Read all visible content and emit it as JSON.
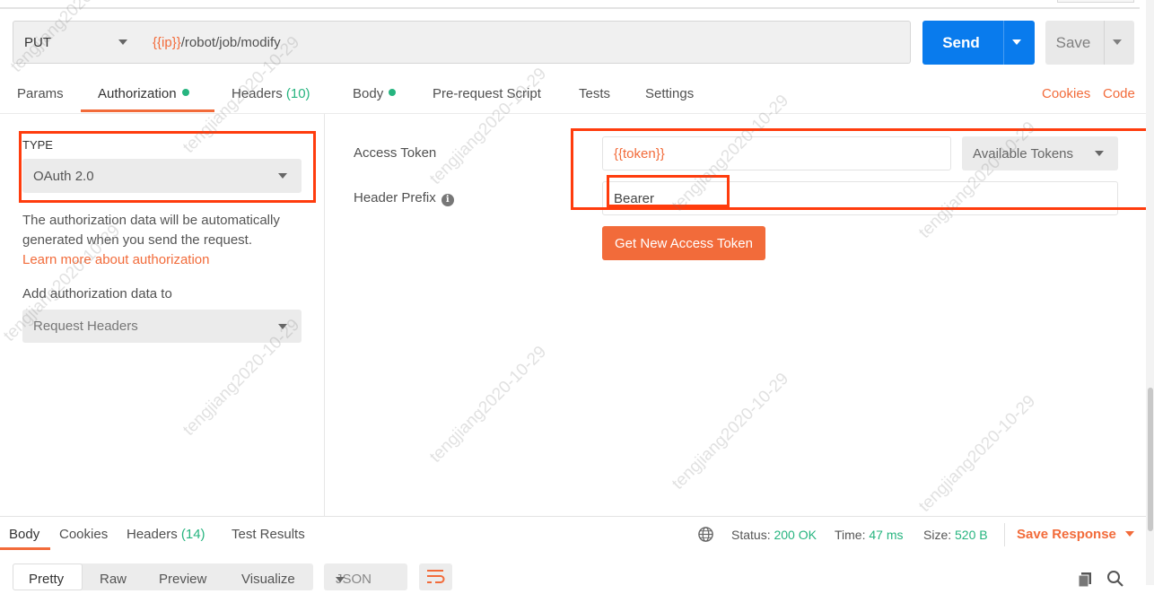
{
  "request": {
    "method": "PUT",
    "url_var": "{{ip}}",
    "url_path": "/robot/job/modify",
    "send_label": "Send",
    "save_label": "Save"
  },
  "tabs": [
    {
      "label": "Params"
    },
    {
      "label": "Authorization"
    },
    {
      "label": "Headers",
      "count": "(10)"
    },
    {
      "label": "Body"
    },
    {
      "label": "Pre-request Script"
    },
    {
      "label": "Tests"
    },
    {
      "label": "Settings"
    }
  ],
  "links": {
    "cookies": "Cookies",
    "code": "Code"
  },
  "auth": {
    "type_label": "TYPE",
    "type_value": "OAuth 2.0",
    "description": "The authorization data will be automatically generated when you send the request.",
    "learn_more": "Learn more about authorization",
    "add_to_label": "Add authorization data to",
    "add_to_value": "Request Headers"
  },
  "fields": {
    "access_token_label": "Access Token",
    "access_token_value": "{{token}}",
    "available_tokens": "Available Tokens",
    "header_prefix_label": "Header Prefix",
    "header_prefix_value": "Bearer",
    "get_token_button": "Get New Access Token"
  },
  "response": {
    "tabs": [
      {
        "label": "Body"
      },
      {
        "label": "Cookies"
      },
      {
        "label": "Headers",
        "count": "(14)"
      },
      {
        "label": "Test Results"
      }
    ],
    "status_label": "Status:",
    "status_value": "200 OK",
    "time_label": "Time:",
    "time_value": "47 ms",
    "size_label": "Size:",
    "size_value": "520 B",
    "save_response": "Save Response",
    "views": [
      "Pretty",
      "Raw",
      "Preview",
      "Visualize"
    ],
    "format": "JSON"
  },
  "watermark": "tengjiang2020-10-29",
  "colors": {
    "accent": "#f26b3a",
    "send": "#097bed",
    "success": "#26b47f",
    "annotation": "#ff3c0d"
  }
}
